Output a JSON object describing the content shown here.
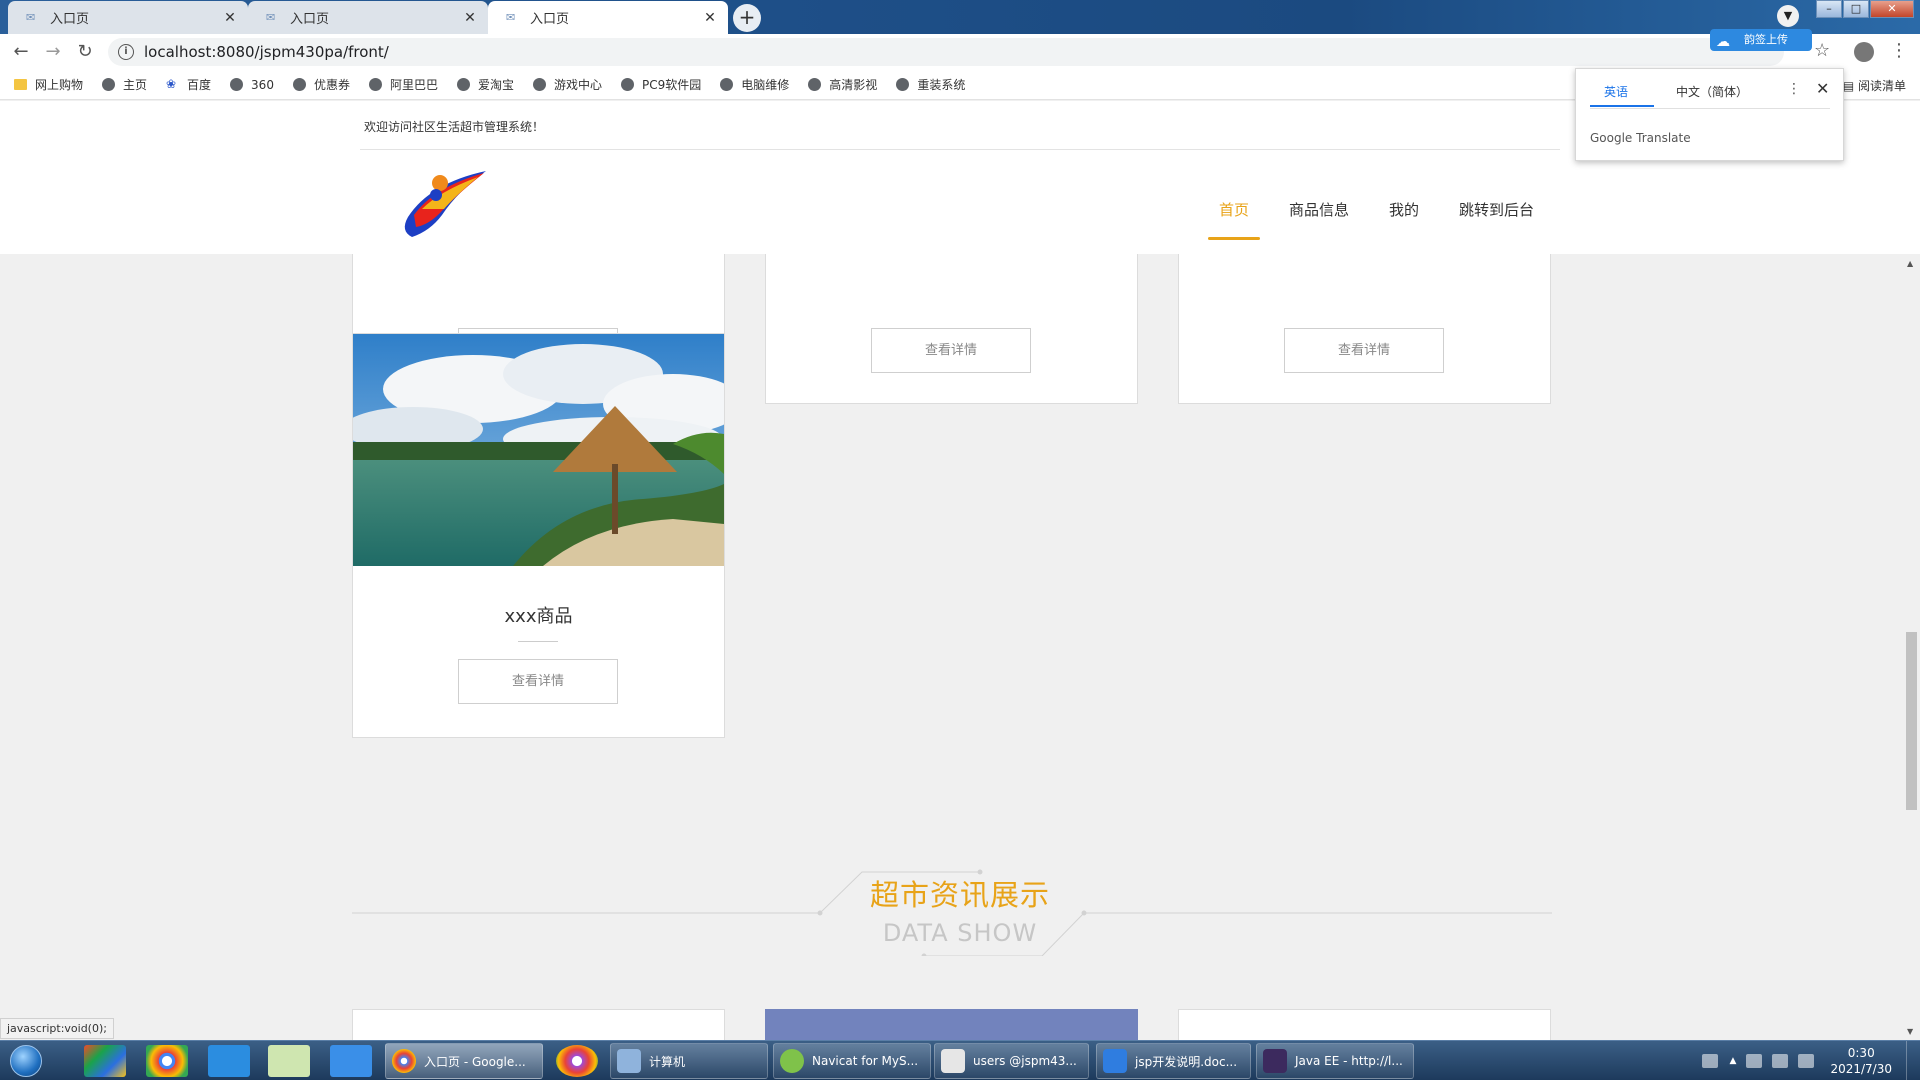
{
  "browser": {
    "tabs": [
      {
        "title": "入口页",
        "active": false
      },
      {
        "title": "入口页",
        "active": false
      },
      {
        "title": "入口页",
        "active": true
      }
    ],
    "url": "localhost:8080/jspm430pa/front/",
    "extension_label": "韵签上传",
    "bookmarks": [
      "网上购物",
      "主页",
      "百度",
      "360",
      "优惠券",
      "阿里巴巴",
      "爱淘宝",
      "游戏中心",
      "PC9软件园",
      "电脑维修",
      "高清影视",
      "重装系统"
    ],
    "reading_list": "阅读清单"
  },
  "translate_popup": {
    "lang_source": "英语",
    "lang_target": "中文（简体）",
    "brand": "Google Translate"
  },
  "site": {
    "welcome": "欢迎访问社区生活超市管理系统！",
    "nav": [
      "首页",
      "商品信息",
      "我的",
      "跳转到后台"
    ],
    "active_nav": "首页"
  },
  "products": {
    "detail_label": "查看详情",
    "featured_name": "xxx商品"
  },
  "section": {
    "title": "超市资讯展示",
    "subtitle": "DATA SHOW"
  },
  "status_bar": "javascript:void(0);",
  "taskbar": {
    "windows": [
      {
        "label": "入口页 - Google...",
        "active": true
      },
      {
        "label": "计算机",
        "active": false
      },
      {
        "label": "Navicat for MyS...",
        "active": false
      },
      {
        "label": "users @jspm43...",
        "active": false
      },
      {
        "label": "jsp开发说明.doc...",
        "active": false
      },
      {
        "label": "Java EE - http://l...",
        "active": false
      }
    ],
    "time": "0:30",
    "date": "2021/7/30"
  },
  "colors": {
    "accent": "#e8a318",
    "info_card": "#7283bd"
  }
}
